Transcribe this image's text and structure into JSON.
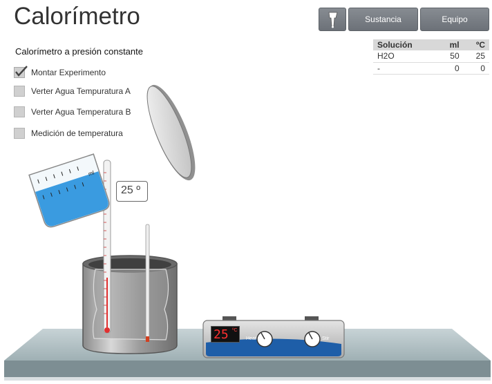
{
  "app": {
    "title": "Calorímetro"
  },
  "toolbar": {
    "icon": "tool-icon",
    "sustancia": "Sustancia",
    "equipo": "Equipo"
  },
  "panel": {
    "subtitle": "Calorímetro a presión constante",
    "steps": [
      {
        "label": "Montar Experimento",
        "checked": true
      },
      {
        "label": "Verter  Agua  Tempuratura A",
        "checked": false
      },
      {
        "label": "Verter  Agua  Temperatura B",
        "checked": false
      },
      {
        "label": "Medición de temperatura",
        "checked": false
      }
    ]
  },
  "table": {
    "headers": [
      "Solución",
      "ml",
      "ºC"
    ],
    "rows": [
      [
        "H2O",
        "50",
        "25"
      ],
      [
        "-",
        "0",
        "0"
      ]
    ]
  },
  "beaker": {
    "label": "ml"
  },
  "thermometer": {
    "readout": "25",
    "unit": "º"
  },
  "hotplate": {
    "temp": "25",
    "unit": "ºC",
    "heat_label": "Heat",
    "stir_label": "Stir"
  },
  "colors": {
    "water": "#3a9be0",
    "display": "#ff3030",
    "button": "#777c82"
  }
}
